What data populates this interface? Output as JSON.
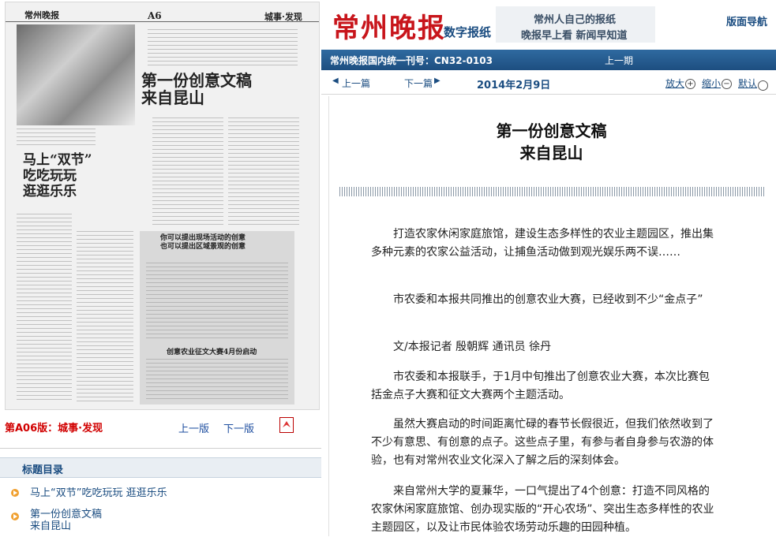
{
  "newspaper": {
    "logo": "常州晚报",
    "logo_sub": "数字报纸",
    "slogan_line1": "常州人自己的报纸",
    "slogan_line2": "晚报早上看 新闻早知道",
    "nav_link": "版面导航",
    "issn": "常州晚报国内统一刊号：CN32-0103",
    "prev_issue": "上一期"
  },
  "toolbar": {
    "prev_article": "上一篇",
    "next_article": "下一篇",
    "date": "2014年2月9日",
    "zoom_in": "放大",
    "zoom_out": "缩小",
    "zoom_default": "默认"
  },
  "article": {
    "title_line1": "第一份创意文稿",
    "title_line2": "来自昆山",
    "paragraphs": [
      "打造农家休闲家庭旅馆，建设生态多样性的农业主题园区，推出集多种元素的农家公益活动，让捕鱼活动做到观光娱乐两不误……",
      "市农委和本报共同推出的创意农业大赛，已经收到不少“金点子”",
      "文/本报记者 殷朝辉 通讯员 徐丹",
      "市农委和本报联手，于1月中旬推出了创意农业大赛，本次比赛包括金点子大赛和征文大赛两个主题活动。",
      "虽然大赛启动的时间距离忙碌的春节长假很近，但我们依然收到了不少有意思、有创意的点子。这些点子里，有参与者自身参与农游的体验，也有对常州农业文化深入了解之后的深刻体会。",
      "来自常州大学的夏蒹华，一口气提出了4个创意：打造不同风格的农家休闲家庭旅馆、创办现实版的“开心农场”、突出生态多样性的农业主题园区，以及让市民体验农场劳动乐趣的田园种植。"
    ]
  },
  "page_view": {
    "page_label": "第A06版：城事·发现",
    "prev_page": "上一版",
    "next_page": "下一版",
    "scan": {
      "masthead": "常州晚报",
      "page_no": "A6",
      "section": "城事·发现",
      "headline_right": "第一份创意文稿\n来自昆山",
      "headline_left": "马上“双节”\n吃吃玩玩\n逛逛乐乐",
      "box_title": "你可以提出现场活动的创意\n也可以提出区域景观的创意",
      "box_sub": "创意农业征文大赛4月份启动"
    }
  },
  "toc": {
    "title": "标题目录",
    "items": [
      {
        "label": "马上“双节”吃吃玩玩 逛逛乐乐"
      },
      {
        "label_line1": "第一份创意文稿",
        "label_line2": "来自昆山"
      }
    ]
  }
}
